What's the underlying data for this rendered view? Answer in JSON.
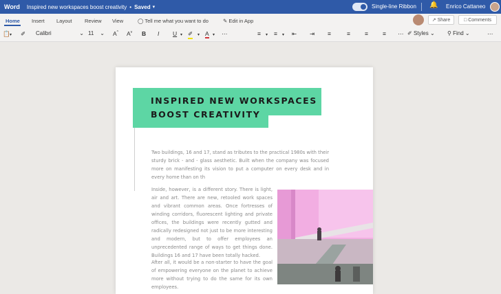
{
  "titlebar": {
    "app_name": "Word",
    "doc_title": "Inspired new workspaces boost creativity",
    "separator": "•",
    "status": "Saved",
    "ribbon_toggle_label": "Single-line Ribbon",
    "user_name": "Enrico Cattaneo"
  },
  "tabs": [
    "Home",
    "Insert",
    "Layout",
    "Review",
    "View"
  ],
  "tell_me": "Tell me what you want to do",
  "edit_in_app": "Edit in App",
  "share_label": "Share",
  "comments_label": "Comments",
  "toolbar": {
    "font_name": "Calibri",
    "font_size": "11",
    "styles_label": "Styles",
    "find_label": "Find"
  },
  "document": {
    "heading_line1": "INSPIRED NEW WORKSPACES",
    "heading_line2": "BOOST CREATIVITY",
    "paragraph1": "Two buildings, 16 and 17, stand as tributes to the practical 1980s with their sturdy brick - and - glass aesthetic. Built when the company was focused more on manifesting its vision to put a computer on every desk and in every home than on th",
    "paragraph2": "Inside, however, is a different story. There is light, air and art. There are new, retooled work spaces and vibrant common areas. Once fortresses of winding corridors, fluorescent lighting and private offices, the buildings were recently gutted and radically redesigned not just to be more interesting and modern, but to offer employees an unprecedented range of ways to get things done. Buildings 16 and 17 have been totally hacked.",
    "paragraph3": "After all, it would be a non-starter to have the goal of empowering everyone on the planet to achieve more without trying to do the same for its own employees."
  },
  "colors": {
    "brand_blue": "#2f5aa8",
    "heading_green": "#5dd6a4",
    "photo_pink": "#f0a9df"
  }
}
